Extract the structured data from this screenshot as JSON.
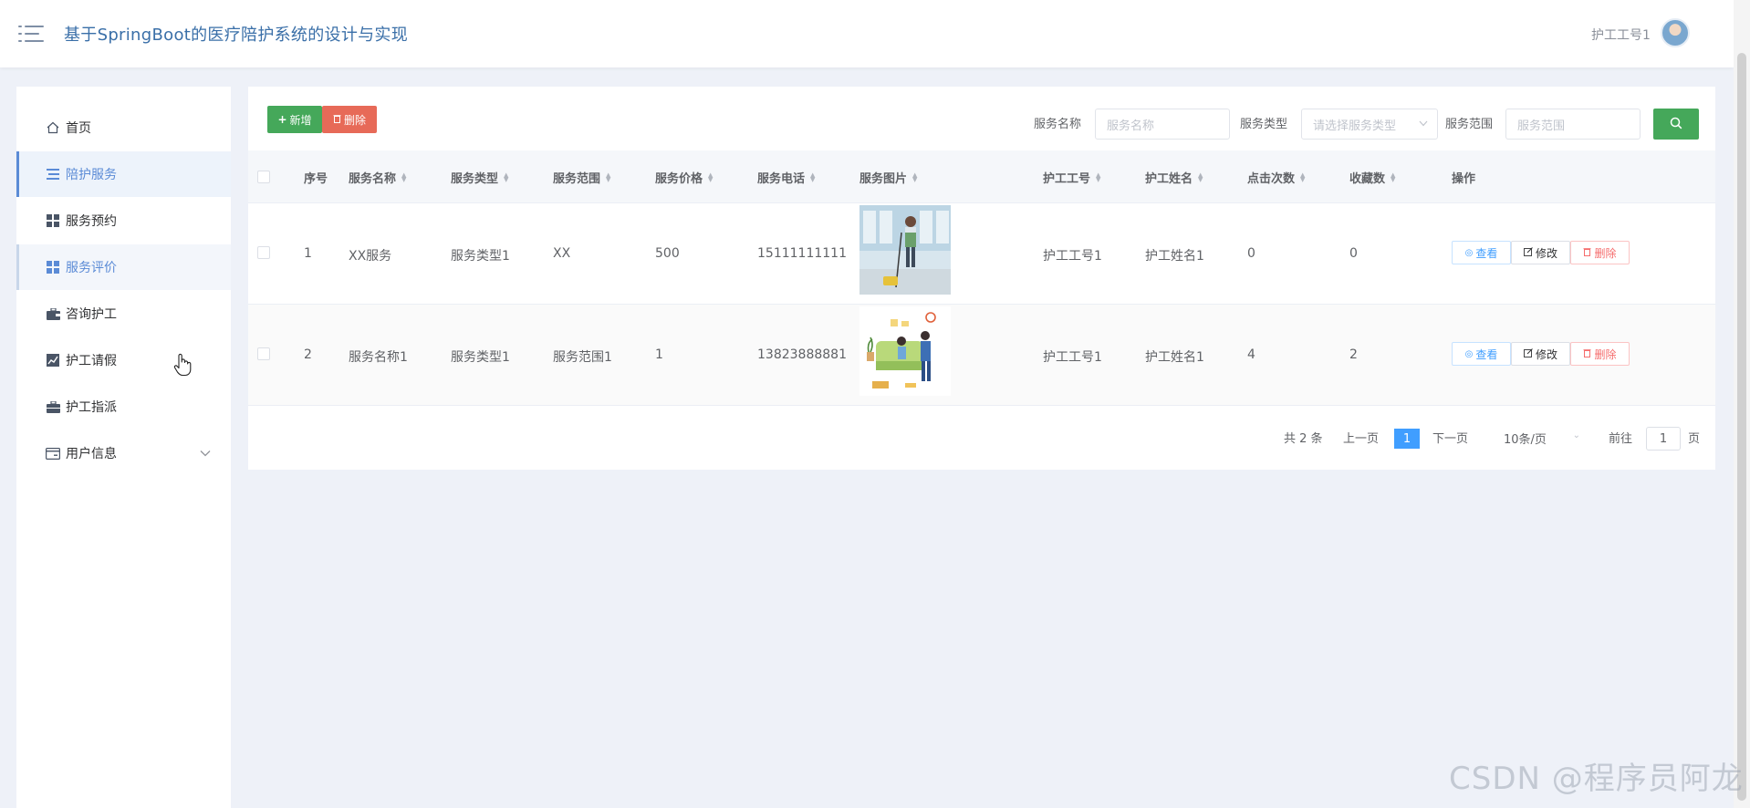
{
  "header": {
    "title": "基于SpringBoot的医疗陪护系统的设计与实现",
    "user_name": "护工工号1"
  },
  "sidebar": {
    "items": [
      {
        "label": "首页",
        "icon": "home-icon"
      },
      {
        "label": "陪护服务",
        "icon": "list-icon",
        "state": "active"
      },
      {
        "label": "服务预约",
        "icon": "grid-icon"
      },
      {
        "label": "服务评价",
        "icon": "grid-icon",
        "state": "hovered"
      },
      {
        "label": "咨询护工",
        "icon": "briefcase-icon"
      },
      {
        "label": "护工请假",
        "icon": "chart-icon"
      },
      {
        "label": "护工指派",
        "icon": "suitcase-icon"
      },
      {
        "label": "用户信息",
        "icon": "card-icon",
        "expandable": true
      }
    ]
  },
  "toolbar": {
    "add_label": "新增",
    "delete_label": "删除"
  },
  "search": {
    "service_name_label": "服务名称",
    "service_name_placeholder": "服务名称",
    "service_type_label": "服务类型",
    "service_type_placeholder": "请选择服务类型",
    "service_scope_label": "服务范围",
    "service_scope_placeholder": "服务范围"
  },
  "table": {
    "columns": [
      "序号",
      "服务名称",
      "服务类型",
      "服务范围",
      "服务价格",
      "服务电话",
      "服务图片",
      "护工工号",
      "护工姓名",
      "点击次数",
      "收藏数",
      "操作"
    ],
    "rows": [
      {
        "index": "1",
        "name": "XX服务",
        "type": "服务类型1",
        "scope": "XX",
        "price": "500",
        "phone": "15111111111",
        "nurse_id": "护工工号1",
        "nurse_name": "护工姓名1",
        "clicks": "0",
        "favorites": "0"
      },
      {
        "index": "2",
        "name": "服务名称1",
        "type": "服务类型1",
        "scope": "服务范围1",
        "price": "1",
        "phone": "13823888881",
        "nurse_id": "护工工号1",
        "nurse_name": "护工姓名1",
        "clicks": "4",
        "favorites": "2"
      }
    ],
    "actions": {
      "view": "查看",
      "edit": "修改",
      "delete": "删除"
    }
  },
  "pagination": {
    "total": "共 2 条",
    "prev": "上一页",
    "current": "1",
    "next": "下一页",
    "page_size": "10条/页",
    "goto_label": "前往",
    "goto_value": "1",
    "page_unit": "页"
  },
  "watermark": "CSDN @程序员阿龙",
  "colors": {
    "primary_green": "#45a85a",
    "danger_red": "#e76a58",
    "link_blue": "#409eff",
    "sidebar_active": "#5b8bd6"
  }
}
